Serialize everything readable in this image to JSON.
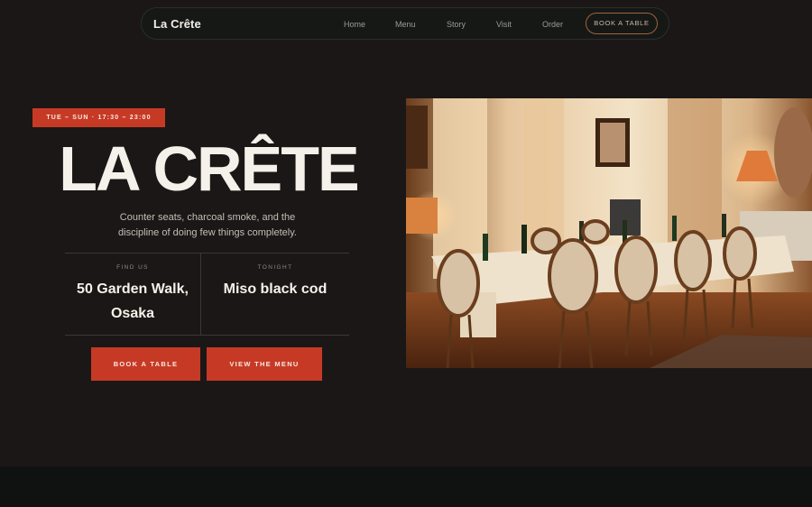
{
  "nav": {
    "brand": "La Crête",
    "links": [
      "Home",
      "Menu",
      "Story",
      "Visit",
      "Order"
    ],
    "cta": "BOOK A TABLE"
  },
  "hero": {
    "badge": "TUE – SUN · 17:30 – 23:00",
    "title": "LA CRÊTE",
    "subtitle_line1": "Counter seats, charcoal smoke, and the",
    "subtitle_line2": "discipline of doing few things completely.",
    "facts": [
      {
        "label": "FIND US",
        "value_line1": "50 Garden Walk,",
        "value_line2": "Osaka"
      },
      {
        "label": "TONIGHT",
        "value_line1": "Miso black cod",
        "value_line2": ""
      }
    ],
    "buttons": {
      "book": "BOOK A TABLE",
      "menu": "VIEW THE MENU"
    }
  },
  "colors": {
    "background": "#1b1716",
    "accent": "#c63a25",
    "footer": "#0f1211"
  }
}
